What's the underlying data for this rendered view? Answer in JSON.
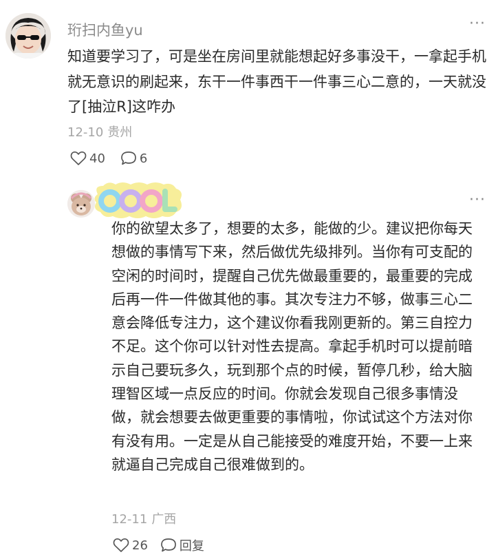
{
  "comment": {
    "username": "珩扫内鱼yu",
    "text": "知道要学习了，可是坐在房间里就能想起好多事没干，一拿起手机就无意识的刷起来，东干一件事西干一件事三心二意的，一天就没了[抽泣R]这咋办",
    "date": "12-10",
    "location": "贵州",
    "likes": "40",
    "replies": "6",
    "more": "···"
  },
  "reply": {
    "badge_text": "COOL",
    "text": "你的欲望太多了，想要的太多，能做的少。建议把你每天想做的事情写下来，然后做优先级排列。当你有可支配的空闲的时间时，提醒自己优先做最重要的，最重要的完成后再一件一件做其他的事。其次专注力不够，做事三心二意会降低专注力，这个建议你看我刚更新的。第三自控力不足。这个你可以针对性去提高。拿起手机时可以提前暗示自己要玩多久，玩到那个点的时候，暂停几秒，给大脑理智区域一点反应的时间。你就会发现自己很多事情没做，就会想要去做更重要的事情啦，你试试这个方法对你有没有用。一定是从自己能接受的难度开始，不要一上来就逼自己完成自己很难做到的。",
    "date": "12-11",
    "location": "广西",
    "likes": "26",
    "reply_label": "回复",
    "more": "···"
  }
}
